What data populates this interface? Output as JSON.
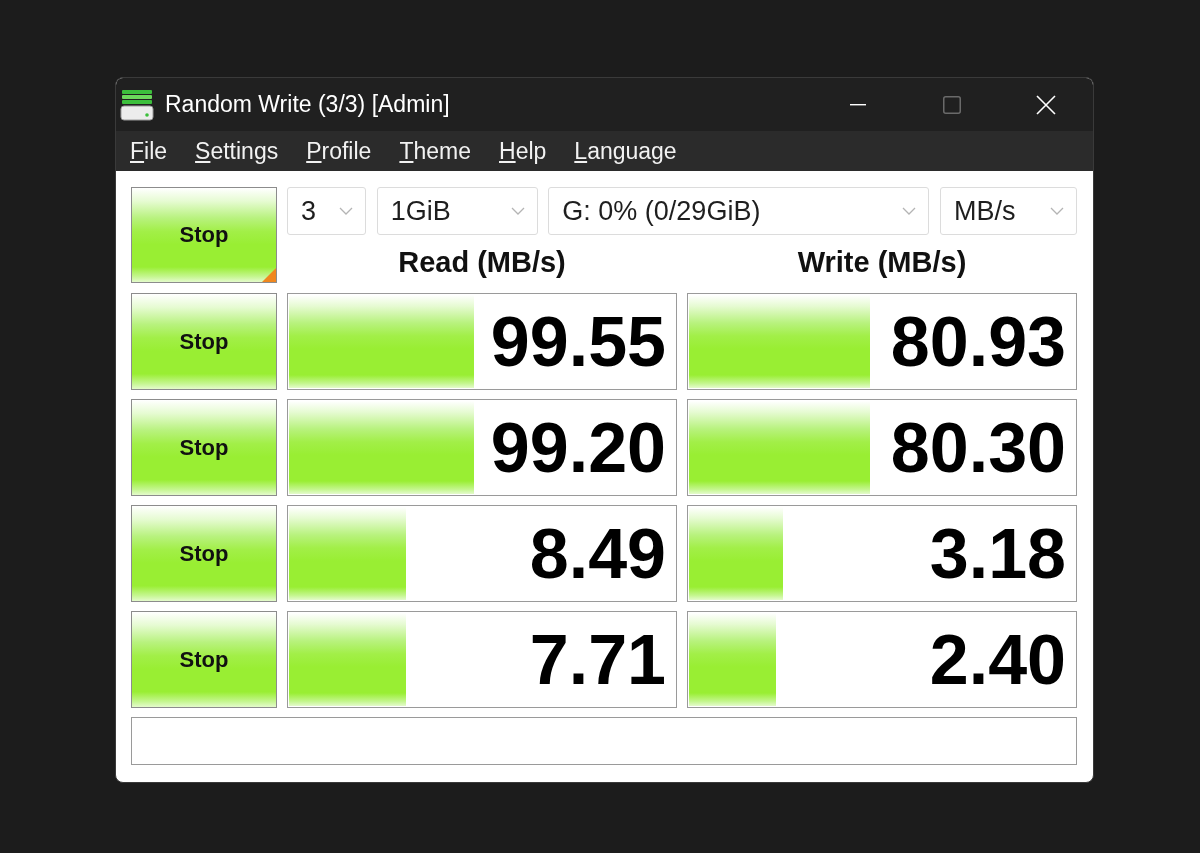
{
  "window": {
    "title": "Random Write (3/3) [Admin]",
    "maximize_disabled": true
  },
  "menu": [
    "File",
    "Settings",
    "Profile",
    "Theme",
    "Help",
    "Language"
  ],
  "all_button": {
    "label": "Stop",
    "corner_mark": true
  },
  "selects": [
    "3",
    "1GiB",
    "G: 0% (0/29GiB)",
    "MB/s"
  ],
  "headers": {
    "read": "Read (MB/s)",
    "write": "Write (MB/s)"
  },
  "rows": [
    {
      "button": {
        "label": "Stop",
        "corner_mark": false
      },
      "read": {
        "value": "99.55",
        "level": 0.49
      },
      "write": {
        "value": "80.93",
        "level": 0.48
      }
    },
    {
      "button": {
        "label": "Stop",
        "corner_mark": false
      },
      "read": {
        "value": "99.20",
        "level": 0.49
      },
      "write": {
        "value": "80.30",
        "level": 0.48
      }
    },
    {
      "button": {
        "label": "Stop",
        "corner_mark": false
      },
      "read": {
        "value": "8.49",
        "level": 0.31
      },
      "write": {
        "value": "3.18",
        "level": 0.25
      }
    },
    {
      "button": {
        "label": "Stop",
        "corner_mark": false
      },
      "read": {
        "value": "7.71",
        "level": 0.31
      },
      "write": {
        "value": "2.40",
        "level": 0.23
      }
    }
  ]
}
